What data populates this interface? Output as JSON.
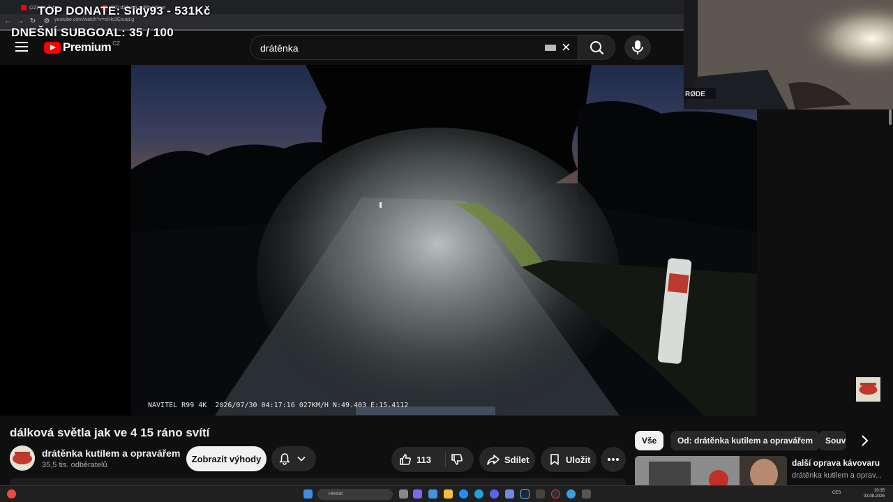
{
  "overlay": {
    "top_donate": "TOP DONATE: Sidy93 - 531Kč",
    "subgoal": "DNEŠNÍ SUBGOAL: 35 / 100"
  },
  "browser": {
    "tabs": [
      {
        "label": "(22) YouTube"
      },
      {
        "label": "(22) dálková světla jak ve"
      }
    ],
    "url": "youtube.com/watch?v=sIHc3GsuqLg"
  },
  "header": {
    "brand": "Premium",
    "country": "CZ",
    "search_value": "drátěnka"
  },
  "video": {
    "osd": "NAVITEL R99 4K  2026/07/30 04:17:16 027KM/H N:49.403 E:15.4112",
    "title": "dálková světla jak ve 4 15 ráno svítí"
  },
  "channel": {
    "name": "drátěnka kutilem a opravářem",
    "subscribers": "35,5 tis. odběratelů",
    "join_label": "Zobrazit výhody"
  },
  "actions": {
    "likes": "113",
    "share_label": "Sdílet",
    "save_label": "Uložit"
  },
  "chips": {
    "all": "Vše",
    "from": "Od: drátěnka kutilem a opravářem",
    "related": "Souv"
  },
  "recommendation": {
    "title": "další oprava kávovaru",
    "channel": "drátěnka kutilem a oprav..."
  },
  "taskbar": {
    "search_placeholder": "Hledat",
    "language": "CES",
    "time": "20:35",
    "date": "03.08.2026"
  },
  "colors": {
    "yt_red": "#ff0000",
    "bg": "#0f0f0f",
    "chip_bg": "#272727"
  }
}
